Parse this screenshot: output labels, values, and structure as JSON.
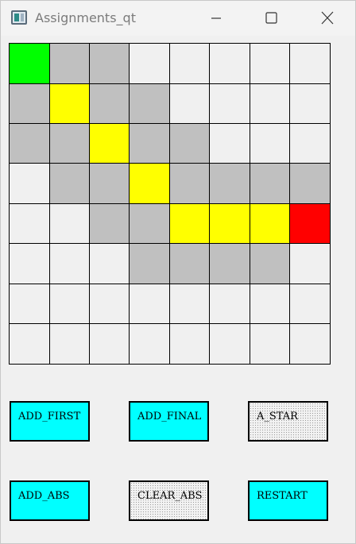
{
  "window": {
    "title": "Assignments_qt",
    "icons": {
      "app": "app-icon",
      "minimize": "minimize-icon",
      "maximize": "maximize-icon",
      "close": "close-icon"
    }
  },
  "colors": {
    "green": "#00ff00",
    "yellow": "#ffff00",
    "gray": "#c0c0c0",
    "red": "#ff0000",
    "empty": "#f0f0f0",
    "cyan": "#00ffff",
    "dotted": "#f2f2f2"
  },
  "grid": {
    "rows": [
      [
        "green",
        "gray",
        "gray",
        "empty",
        "empty",
        "empty",
        "empty",
        "empty"
      ],
      [
        "gray",
        "yellow",
        "gray",
        "gray",
        "empty",
        "empty",
        "empty",
        "empty"
      ],
      [
        "gray",
        "gray",
        "yellow",
        "gray",
        "gray",
        "empty",
        "empty",
        "empty"
      ],
      [
        "empty",
        "gray",
        "gray",
        "yellow",
        "gray",
        "gray",
        "gray",
        "gray"
      ],
      [
        "empty",
        "empty",
        "gray",
        "gray",
        "yellow",
        "yellow",
        "yellow",
        "red"
      ],
      [
        "empty",
        "empty",
        "empty",
        "gray",
        "gray",
        "gray",
        "gray",
        "empty"
      ],
      [
        "empty",
        "empty",
        "empty",
        "empty",
        "empty",
        "empty",
        "empty",
        "empty"
      ],
      [
        "empty",
        "empty",
        "empty",
        "empty",
        "empty",
        "empty",
        "empty",
        "empty"
      ]
    ]
  },
  "buttons": {
    "add_first": {
      "label": "ADD_FIRST",
      "style": "cyan"
    },
    "add_final": {
      "label": "ADD_FINAL",
      "style": "cyan"
    },
    "a_star": {
      "label": "A_STAR",
      "style": "dotted"
    },
    "add_abs": {
      "label": "ADD_ABS",
      "style": "cyan"
    },
    "clear_abs": {
      "label": "CLEAR_ABS",
      "style": "dotted"
    },
    "restart": {
      "label": "RESTART",
      "style": "cyan"
    }
  }
}
